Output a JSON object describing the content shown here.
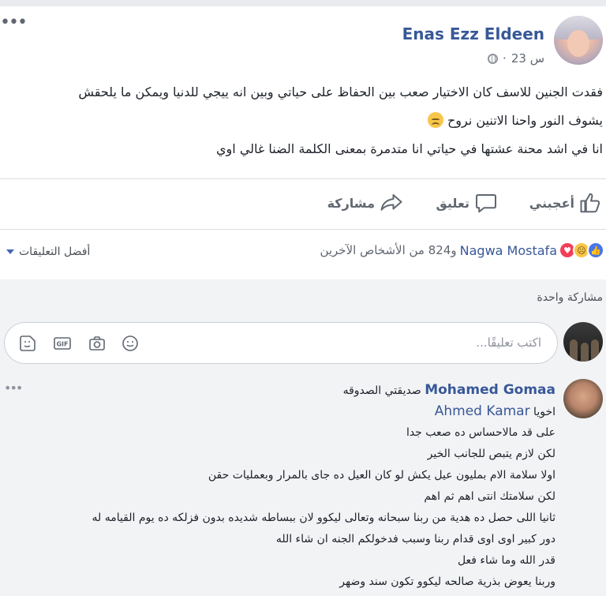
{
  "post": {
    "author": "Enas Ezz Eldeen",
    "time": "23 س",
    "separator": "·",
    "text_line_1": "فقدت الجنين للاسف كان الاختيار صعب بين الحفاظ على حياتي وبين انه ييجي للدنيا ويمكن ما يلحقش",
    "text_line_2": "يشوف النور واحنا الاتنين نروح",
    "text_line_3": "انا في اشد محنة عشتها في حياتي انا متدمرة بمعنى الكلمة الضنا غالي اوي",
    "sad_emoji": "sad-face-icon"
  },
  "actions": {
    "like": "أعجبني",
    "comment": "تعليق",
    "share": "مشاركة"
  },
  "reactions": {
    "name": "Nagwa Mostafa",
    "rest": "و824 من الأشخاص الآخرين",
    "best_comments": "أفضل التعليقات"
  },
  "shares": "مشاركة واحدة",
  "comment_input": {
    "placeholder": "اكتب تعليقًا..."
  },
  "comment": {
    "author": "Mohamed Gomaa",
    "first_text": "صديقتي الصدوقه",
    "prefix": "اخويا",
    "mention": "Ahmed Kamar",
    "lines": [
      "على قد مالاحساس ده صعب جدا",
      "لكن لازم يتبص للجانب الخير",
      "اولا سلامة الام بمليون عيل يكش لو كان العيل ده جاى بالمرار وبعمليات حقن",
      "لكن سلامتك انتى اهم ثم اهم",
      "ثانيا اللى حصل ده هدية من ربنا سبحانه وتعالى ليكوو لان ببساطه شديده بدون فزلكه ده يوم القيامه له",
      "دور كبير اوى اوى قدام ربنا وسبب فدخولكم الجنه ان شاء الله",
      "قدر الله وما شاء فعل",
      "وربنا يعوض بذرية صالحه ليكوو تكون سند وضهر"
    ]
  },
  "colors": {
    "link": "#385898",
    "background": "#e9ebee",
    "secondary_text": "#606770"
  }
}
